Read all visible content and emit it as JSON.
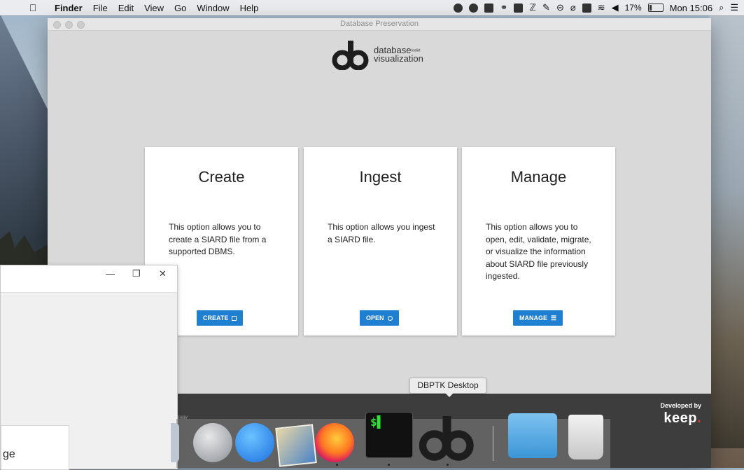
{
  "menubar": {
    "app_name": "Finder",
    "menus": [
      "File",
      "Edit",
      "View",
      "Go",
      "Window",
      "Help"
    ],
    "battery_percent": "17%",
    "clock": "Mon 15:06",
    "status_icons": [
      "control-center-icon",
      "cloud-icon",
      "app-icon",
      "glasses-icon",
      "docker-icon",
      "translate-icon",
      "pen-icon",
      "vpn-icon",
      "paperclip-icon",
      "keyboard-icon",
      "wifi-icon",
      "volume-icon"
    ]
  },
  "app_window": {
    "title": "Database Preservation",
    "logo": {
      "line1": "database",
      "small": "toolkit",
      "line2": "visualization"
    },
    "cards": [
      {
        "title": "Create",
        "description": "This option allows you to create a SIARD file from a supported DBMS.",
        "button": "CREATE",
        "button_icon": "edit-icon"
      },
      {
        "title": "Ingest",
        "description": "This option allows you ingest a SIARD file.",
        "button": "OPEN",
        "button_icon": "gear-icon"
      },
      {
        "title": "Manage",
        "description": "This option allows you to open, edit, validate, migrate, or visualize the information about SIARD file previously ingested.",
        "button": "MANAGE",
        "button_icon": "list-icon"
      }
    ],
    "footer": {
      "left_text": "ARHIIV",
      "developed_by": "Developed by",
      "keep_logo": "keep",
      "keep_dot": "."
    }
  },
  "background_window": {
    "controls": [
      "—",
      "❐",
      "✕"
    ],
    "partial_text": "ge"
  },
  "dock": {
    "tooltip": "DBPTK Desktop",
    "terminal_prompt": "$▌"
  },
  "colors": {
    "accent_button": "#1f7fd1",
    "footer_bg": "#3d3d3d",
    "keep_dot": "#e2332a"
  }
}
